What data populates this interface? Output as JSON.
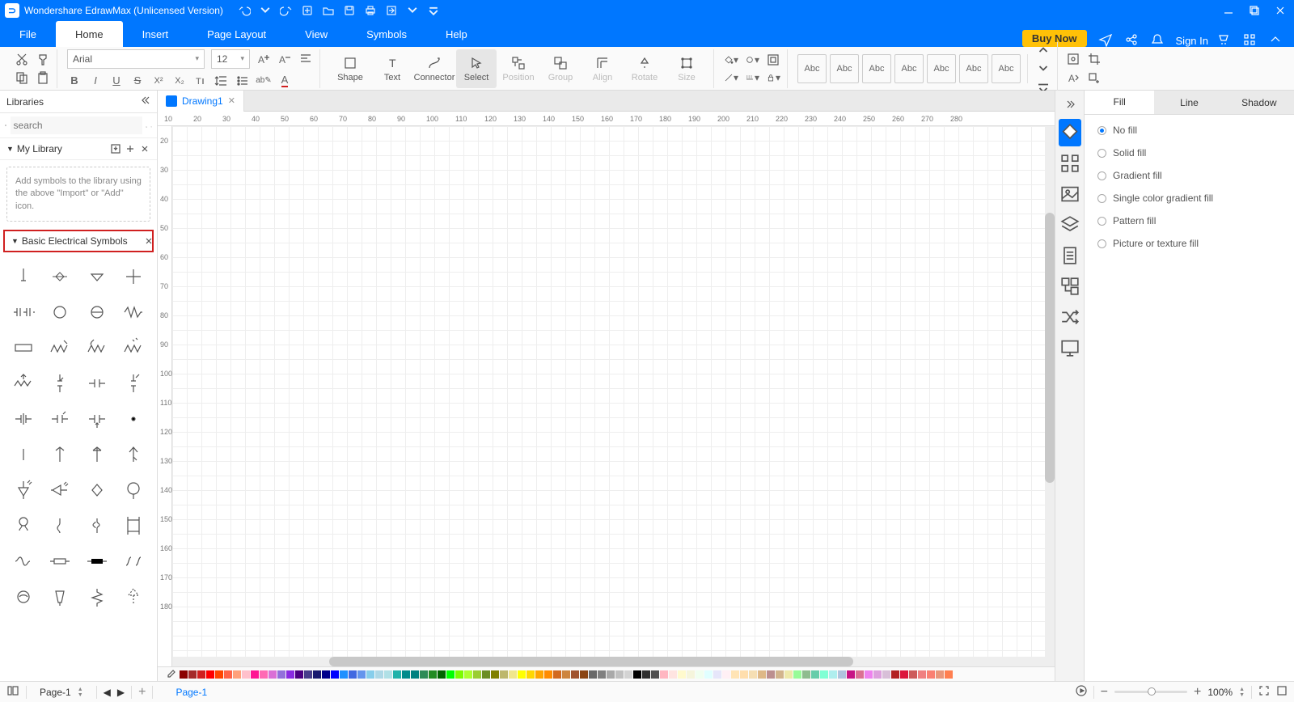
{
  "title": "Wondershare EdrawMax (Unlicensed Version)",
  "menus": [
    "File",
    "Home",
    "Insert",
    "Page Layout",
    "View",
    "Symbols",
    "Help"
  ],
  "active_menu": "Home",
  "buy_label": "Buy Now",
  "signin_label": "Sign In",
  "font_name": "Arial",
  "font_size": "12",
  "big_buttons": [
    {
      "label": "Shape",
      "active": false,
      "disabled": false
    },
    {
      "label": "Text",
      "active": false,
      "disabled": false
    },
    {
      "label": "Connector",
      "active": false,
      "disabled": false
    },
    {
      "label": "Select",
      "active": true,
      "disabled": false
    },
    {
      "label": "Position",
      "active": false,
      "disabled": true
    },
    {
      "label": "Group",
      "active": false,
      "disabled": true
    },
    {
      "label": "Align",
      "active": false,
      "disabled": true
    },
    {
      "label": "Rotate",
      "active": false,
      "disabled": true
    },
    {
      "label": "Size",
      "active": false,
      "disabled": true
    }
  ],
  "theme_label": "Abc",
  "libraries_title": "Libraries",
  "search_placeholder": "search",
  "mylib_title": "My Library",
  "mylib_hint": "Add symbols to the library using the above \"Import\" or \"Add\" icon.",
  "basic_title": "Basic Electrical Symbols",
  "doc_tab": "Drawing1",
  "ruler_h": [
    "10",
    "20",
    "30",
    "40",
    "50",
    "60",
    "70",
    "80",
    "90",
    "100",
    "110",
    "120",
    "130",
    "140",
    "150",
    "160",
    "170",
    "180",
    "190",
    "200",
    "210",
    "220",
    "230",
    "240",
    "250",
    "260",
    "270",
    "280"
  ],
  "ruler_v": [
    "20",
    "30",
    "40",
    "50",
    "60",
    "70",
    "80",
    "90",
    "100",
    "110",
    "120",
    "130",
    "140",
    "150",
    "160",
    "170",
    "180"
  ],
  "right_tabs": [
    "Fill",
    "Line",
    "Shadow"
  ],
  "right_active": "Fill",
  "fill_options": [
    "No fill",
    "Solid fill",
    "Gradient fill",
    "Single color gradient fill",
    "Pattern fill",
    "Picture or texture fill"
  ],
  "fill_selected": "No fill",
  "page_selector": "Page-1",
  "page_tab": "Page-1",
  "zoom": "100%",
  "palette_colors": [
    "#8b0000",
    "#a52a2a",
    "#d02020",
    "#ff0000",
    "#ff4500",
    "#ff6347",
    "#ffa07a",
    "#ffc0cb",
    "#ff1493",
    "#ff69b4",
    "#da70d6",
    "#9370db",
    "#8a2be2",
    "#4b0082",
    "#483d8b",
    "#191970",
    "#00008b",
    "#0000ff",
    "#1e90ff",
    "#4169e1",
    "#6495ed",
    "#87ceeb",
    "#add8e6",
    "#b0e0e6",
    "#20b2aa",
    "#008b8b",
    "#008080",
    "#2e8b57",
    "#228b22",
    "#006400",
    "#00ff00",
    "#7cfc00",
    "#adff2f",
    "#9acd32",
    "#6b8e23",
    "#808000",
    "#bdb76b",
    "#f0e68c",
    "#ffff00",
    "#ffd700",
    "#ffa500",
    "#ff8c00",
    "#d2691e",
    "#cd853f",
    "#a0522d",
    "#8b4513",
    "#696969",
    "#808080",
    "#a9a9a9",
    "#c0c0c0",
    "#d3d3d3",
    "#000000",
    "#2f2f2f",
    "#4f4f4f",
    "#ffb6c1",
    "#ffe4e1",
    "#fffacd",
    "#f5f5dc",
    "#f0fff0",
    "#e0ffff",
    "#e6e6fa",
    "#fff0f5",
    "#ffe4b5",
    "#ffdead",
    "#f5deb3",
    "#deb887",
    "#bc8f8f",
    "#d2b48c",
    "#eee8aa",
    "#98fb98",
    "#8fbc8f",
    "#66cdaa",
    "#7fffd4",
    "#afeeee",
    "#b0c4de",
    "#c71585",
    "#db7093",
    "#ee82ee",
    "#dda0dd",
    "#d8bfd8",
    "#b22222",
    "#dc143c",
    "#cd5c5c",
    "#f08080",
    "#fa8072",
    "#e9967a",
    "#ff7f50"
  ]
}
